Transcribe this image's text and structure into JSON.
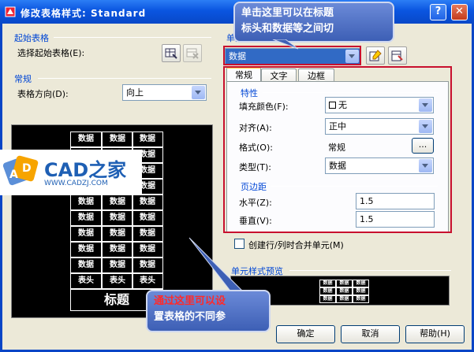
{
  "window": {
    "title": "修改表格样式: Standard",
    "help_glyph": "?",
    "close_glyph": "✕"
  },
  "starting_table": {
    "group": "起始表格",
    "label": "选择起始表格(E):"
  },
  "general": {
    "group": "常规",
    "direction_label": "表格方向(D):",
    "direction_value": "向上"
  },
  "cell_style": {
    "group": "单元样式",
    "selected": "数据",
    "tabs": [
      {
        "label": "常规"
      },
      {
        "label": "文字"
      },
      {
        "label": "边框"
      }
    ],
    "properties": {
      "group": "特性",
      "fill_label": "填充颜色(F):",
      "fill_value": "无",
      "align_label": "对齐(A):",
      "align_value": "正中",
      "format_label": "格式(O):",
      "format_value": "常规",
      "format_button": "...",
      "type_label": "类型(T):",
      "type_value": "数据"
    },
    "margins": {
      "group": "页边距",
      "horizontal_label": "水平(Z):",
      "horizontal_value": "1.5",
      "vertical_label": "垂直(V):",
      "vertical_value": "1.5"
    },
    "merge_checkbox": "创建行/列时合并单元(M)",
    "preview_group": "单元样式预览"
  },
  "preview": {
    "title_text": "标题",
    "header_cells": [
      "表头",
      "表头",
      "表头"
    ],
    "data_cell": "数据",
    "mini_cell": "数据"
  },
  "callouts": {
    "top_line1": "单击这里可以在标题",
    "top_line2": "标头和数据等之间切",
    "bottom_line1": "通过这里可以设",
    "bottom_line2": "置表格的不同参"
  },
  "watermark": {
    "brand": "CAD之家",
    "url": "WWW.CADZJ.COM"
  },
  "buttons": {
    "ok": "确定",
    "cancel": "取消",
    "help": "帮助(H)"
  },
  "colors": {
    "titlebar": "#0a55e0",
    "group_label": "#0046d5",
    "highlight": "#c8102e",
    "callout": "#3d5fb5"
  }
}
